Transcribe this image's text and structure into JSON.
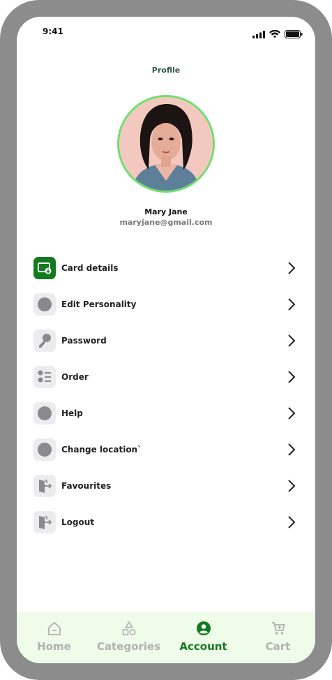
{
  "status_bar": {
    "time": "9:41"
  },
  "header": {
    "title": "Profile"
  },
  "profile": {
    "name": "Mary Jane",
    "email": "maryjane@gmail.com"
  },
  "menu": {
    "items": [
      {
        "label": "Card details",
        "icon": "card-download-icon"
      },
      {
        "label": "Edit Personality",
        "icon": "circle-icon"
      },
      {
        "label": "Password",
        "icon": "key-icon"
      },
      {
        "label": "Order",
        "icon": "list-icon"
      },
      {
        "label": "Help",
        "icon": "circle-icon"
      },
      {
        "label": "Change location`",
        "icon": "circle-icon"
      },
      {
        "label": "Favourites",
        "icon": "door-exit-icon"
      },
      {
        "label": "Logout",
        "icon": "door-exit-icon"
      }
    ]
  },
  "bottom_nav": {
    "items": [
      {
        "label": "Home",
        "icon": "home-icon"
      },
      {
        "label": "Categories",
        "icon": "shapes-icon"
      },
      {
        "label": "Account",
        "icon": "account-icon"
      },
      {
        "label": "Cart",
        "icon": "cart-icon"
      }
    ],
    "active": "Account"
  },
  "colors": {
    "accent": "#137a1f",
    "avatar_ring": "#6ee06e",
    "nav_background": "#eefce9"
  }
}
